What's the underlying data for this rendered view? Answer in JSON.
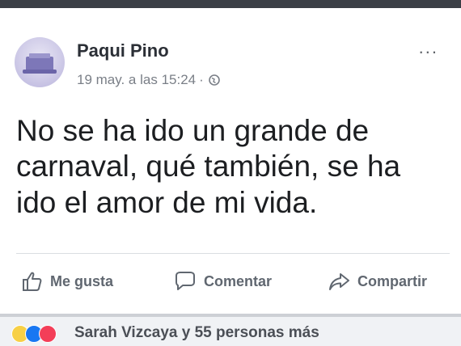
{
  "post": {
    "author": "Paqui Pino",
    "timestamp": "19 may. a las 15:24",
    "separator": "·",
    "privacy_icon": "globe-icon",
    "more_icon": "more-options-icon",
    "more_label": "...",
    "message": "No se ha ido un grande de carnaval, qué también, se ha ido el amor de mi vida."
  },
  "actions": {
    "like_label": "Me gusta",
    "comment_label": "Comentar",
    "share_label": "Compartir"
  },
  "reactions": {
    "icons": [
      "sad-reaction-icon",
      "like-reaction-icon",
      "love-reaction-icon"
    ],
    "summary": "Sarah Vizcaya y 55 personas más"
  },
  "colors": {
    "accent_like": "#1877f2",
    "accent_love": "#f33e58",
    "accent_sad": "#f7d046"
  }
}
